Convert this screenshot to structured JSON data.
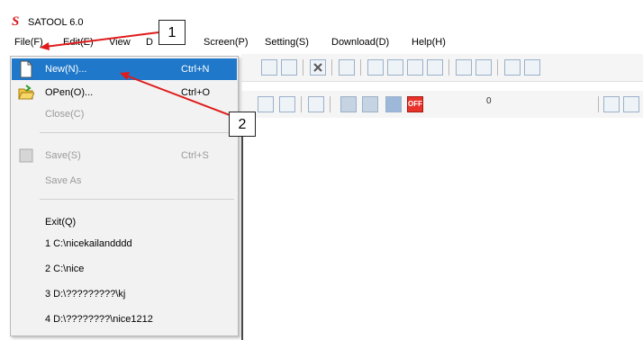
{
  "app": {
    "logo": "S",
    "title": "SATOOL 6.0"
  },
  "menubar": {
    "items": [
      {
        "label": "File(F)"
      },
      {
        "label": "Edit(E)"
      },
      {
        "label": "View"
      },
      {
        "label": "D"
      },
      {
        "label": "Screen(P)"
      },
      {
        "label": "Setting(S)"
      },
      {
        "label": "Download(D)"
      },
      {
        "label": "Help(H)"
      }
    ]
  },
  "file_menu": {
    "items": [
      {
        "label": "New(N)...",
        "shortcut": "Ctrl+N",
        "highlighted": true,
        "enabled": true
      },
      {
        "label": "OPen(O)...",
        "shortcut": "Ctrl+O",
        "enabled": true
      },
      {
        "label": "Close(C)",
        "shortcut": "",
        "enabled": false
      },
      {
        "label": "Save(S)",
        "shortcut": "Ctrl+S",
        "enabled": false
      },
      {
        "label": "Save As",
        "shortcut": "",
        "enabled": false
      },
      {
        "label": "Exit(Q)",
        "shortcut": "",
        "enabled": true
      },
      {
        "label": "1 C:\\nicekailandddd",
        "shortcut": "",
        "enabled": true
      },
      {
        "label": "2 C:\\nice",
        "shortcut": "",
        "enabled": true
      },
      {
        "label": "3 D:\\?????????\\kj",
        "shortcut": "",
        "enabled": true
      },
      {
        "label": "4 D:\\????????\\nice1212",
        "shortcut": "",
        "enabled": true
      }
    ]
  },
  "toolbar": {
    "value_display": "0",
    "off_button_label": "OFF"
  },
  "annotations": {
    "callout_1": "1",
    "callout_2": "2",
    "arrow_color": "#e01b1b"
  }
}
